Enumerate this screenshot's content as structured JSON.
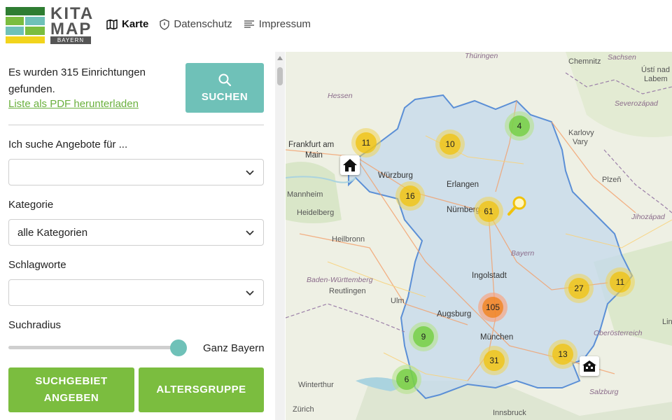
{
  "logo": {
    "line1": "KITA",
    "line2": "MAP",
    "line3": "BAYERN"
  },
  "nav": [
    {
      "label": "Karte",
      "icon": "map-icon",
      "active": true
    },
    {
      "label": "Datenschutz",
      "icon": "shield-icon",
      "active": false
    },
    {
      "label": "Impressum",
      "icon": "list-icon",
      "active": false
    }
  ],
  "sidebar": {
    "result_text": "Es wurden 315 Einrichtungen gefunden.",
    "pdf_link": "Liste als PDF herunterladen",
    "search_button": "Suchen",
    "offers_label": "Ich suche Angebote für ...",
    "offers_value": "",
    "category_label": "Kategorie",
    "category_value": "alle Kategorien",
    "keywords_label": "Schlagworte",
    "keywords_value": "",
    "radius_label": "Suchradius",
    "radius_value": "Ganz Bayern",
    "radius_level": 1.0,
    "area_button": "Suchgebiet angeben",
    "age_button": "Altersgruppe"
  },
  "map": {
    "cities": [
      "Frankfurt am",
      "Main",
      "Würzburg",
      "Erlangen",
      "Nürnberg",
      "Mannheim",
      "Heidelberg",
      "Heilbronn",
      "Ingolstadt",
      "Augsburg",
      "München",
      "Ulm",
      "Reutlingen",
      "Winterthur",
      "Zürich",
      "Innsbruck",
      "Salzburg",
      "Chemnitz",
      "Ústí nad",
      "Labem",
      "Karlovy",
      "Vary",
      "Plzeň",
      "Hessen",
      "Thüringen",
      "Sachsen",
      "Severozápad",
      "Jihozápad",
      "Baden-Württemberg",
      "Bayern",
      "Oberösterreich",
      "Lin"
    ],
    "clusters": [
      {
        "count": "11",
        "color": "yellow"
      },
      {
        "count": "10",
        "color": "yellow"
      },
      {
        "count": "4",
        "color": "green"
      },
      {
        "count": "16",
        "color": "yellow"
      },
      {
        "count": "61",
        "color": "yellow"
      },
      {
        "count": "27",
        "color": "yellow"
      },
      {
        "count": "11",
        "color": "yellow"
      },
      {
        "count": "105",
        "color": "orange"
      },
      {
        "count": "9",
        "color": "green"
      },
      {
        "count": "31",
        "color": "yellow"
      },
      {
        "count": "13",
        "color": "yellow"
      },
      {
        "count": "6",
        "color": "green"
      }
    ],
    "markers": [
      "house-icon",
      "school-icon",
      "search-pin-icon"
    ]
  },
  "colors": {
    "accent_teal": "#6fc1b8",
    "accent_green": "#7bbd3f",
    "link_green": "#6ab03d",
    "bavaria_fill": "#c4d9ec",
    "bavaria_border": "#5b8fd6"
  }
}
